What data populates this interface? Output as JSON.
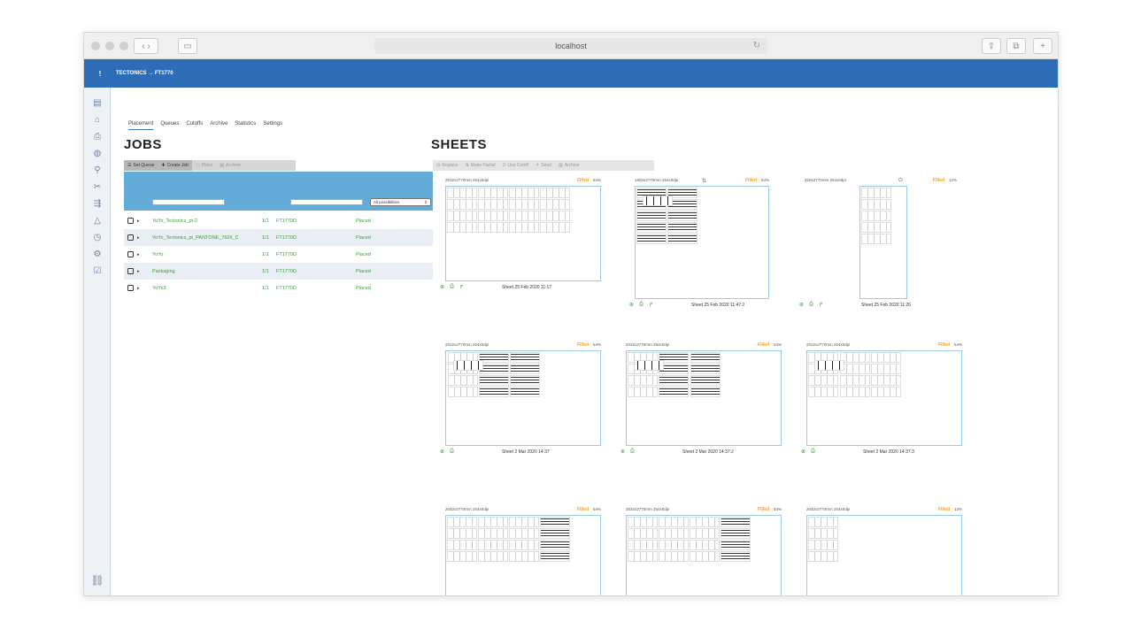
{
  "browser": {
    "url": "localhost"
  },
  "app": {
    "menu_icon": "!",
    "breadcrumb": "TECTONICS → FT1770"
  },
  "tabs": [
    "Placement",
    "Queues",
    "Cutoffs",
    "Archive",
    "Statistics",
    "Settings"
  ],
  "jobs": {
    "title": "JOBS",
    "toolbar": {
      "set_queue": "Set Queue",
      "create_job": "Create Job",
      "place": "Place",
      "archive": "Archive"
    },
    "select_label": "All possibilities",
    "rows": [
      {
        "name": "YoYo_Tectonics_pt-2",
        "count": "1/1",
        "queue": "FT1770D",
        "status": "Placed"
      },
      {
        "name": "YoYo_Tectonics_pt_PANTONE_7626_C",
        "count": "1/1",
        "queue": "FT1770D",
        "status": "Placed"
      },
      {
        "name": "YoYo",
        "count": "1/1",
        "queue": "FT1770D",
        "status": "Placed"
      },
      {
        "name": "Packaging",
        "count": "1/1",
        "queue": "FT1770D",
        "status": "Placed"
      },
      {
        "name": "YoYo3",
        "count": "1/1",
        "queue": "FT1770D",
        "status": "Placed"
      }
    ]
  },
  "sheets": {
    "title": "SHEETS",
    "toolbar": {
      "replace": "Replace",
      "make_partial": "Make Partial",
      "use_cutoff": "Use Cutoff",
      "send": "Send",
      "archive": "Archive"
    },
    "fill_label": "Filled",
    "items": [
      {
        "size": "2032x2770mm 254x0dpi",
        "pct": "54%",
        "label": "Sheet 25 Feb 2020 11:17"
      },
      {
        "size": "1600x2770mm 254x0dpi",
        "pct": "54%",
        "label": "Sheet 25 Feb 2020 11:47:2"
      },
      {
        "size": "320x2770mm 254x0dpi",
        "pct": "12%",
        "label": "Sheet 25 Feb 2020 11:26"
      },
      {
        "size": "2032x2770mm 254x0dpi",
        "pct": "54%",
        "label": "Sheet 2 Mar 2020 14:37"
      },
      {
        "size": "2032x2770mm 254x0dpi",
        "pct": "54%",
        "label": "Sheet 2 Mar 2020 14:37:2"
      },
      {
        "size": "2032x2770mm 254x0dpi",
        "pct": "54%",
        "label": "Sheet 2 Mar 2020 14:37:3"
      },
      {
        "size": "2032x2770mm 254x0dpi",
        "pct": "54%",
        "label": ""
      },
      {
        "size": "2032x2770mm 254x0dpi",
        "pct": "54%",
        "label": ""
      },
      {
        "size": "2032x2770mm 254x0dpi",
        "pct": "13%",
        "label": ""
      }
    ]
  },
  "colors": {
    "appbar": "#2d6db5",
    "jobs_header": "#63acd8",
    "placed": "#3a9a3a",
    "filled": "#f0a020"
  }
}
